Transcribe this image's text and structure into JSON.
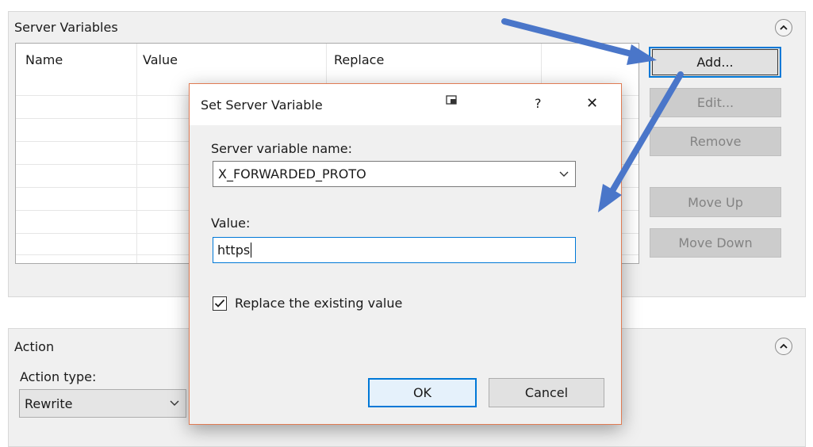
{
  "server_variables_panel": {
    "title": "Server Variables",
    "columns": [
      "Name",
      "Value",
      "Replace"
    ],
    "buttons": {
      "add": "Add...",
      "edit": "Edit...",
      "remove": "Remove",
      "move_up": "Move Up",
      "move_down": "Move Down"
    }
  },
  "action_panel": {
    "title": "Action",
    "action_type_label": "Action type:",
    "action_type_value": "Rewrite"
  },
  "dialog": {
    "title": "Set Server Variable",
    "help": "?",
    "close": "✕",
    "name_label": "Server variable name:",
    "name_value": "X_FORWARDED_PROTO",
    "value_label": "Value:",
    "value_value": "https",
    "replace_checkbox_label": "Replace the existing value",
    "replace_checked": true,
    "ok": "OK",
    "cancel": "Cancel"
  },
  "colors": {
    "accent": "#0078d7",
    "dialog_border": "#e07b53",
    "annotation_arrow": "#4a76c9"
  },
  "icons": {
    "collapse": "chevron-up-circle-icon",
    "dropdown": "chevron-down-icon",
    "dialog_system": "window-restore-icon",
    "checkbox": "checkmark-icon"
  }
}
